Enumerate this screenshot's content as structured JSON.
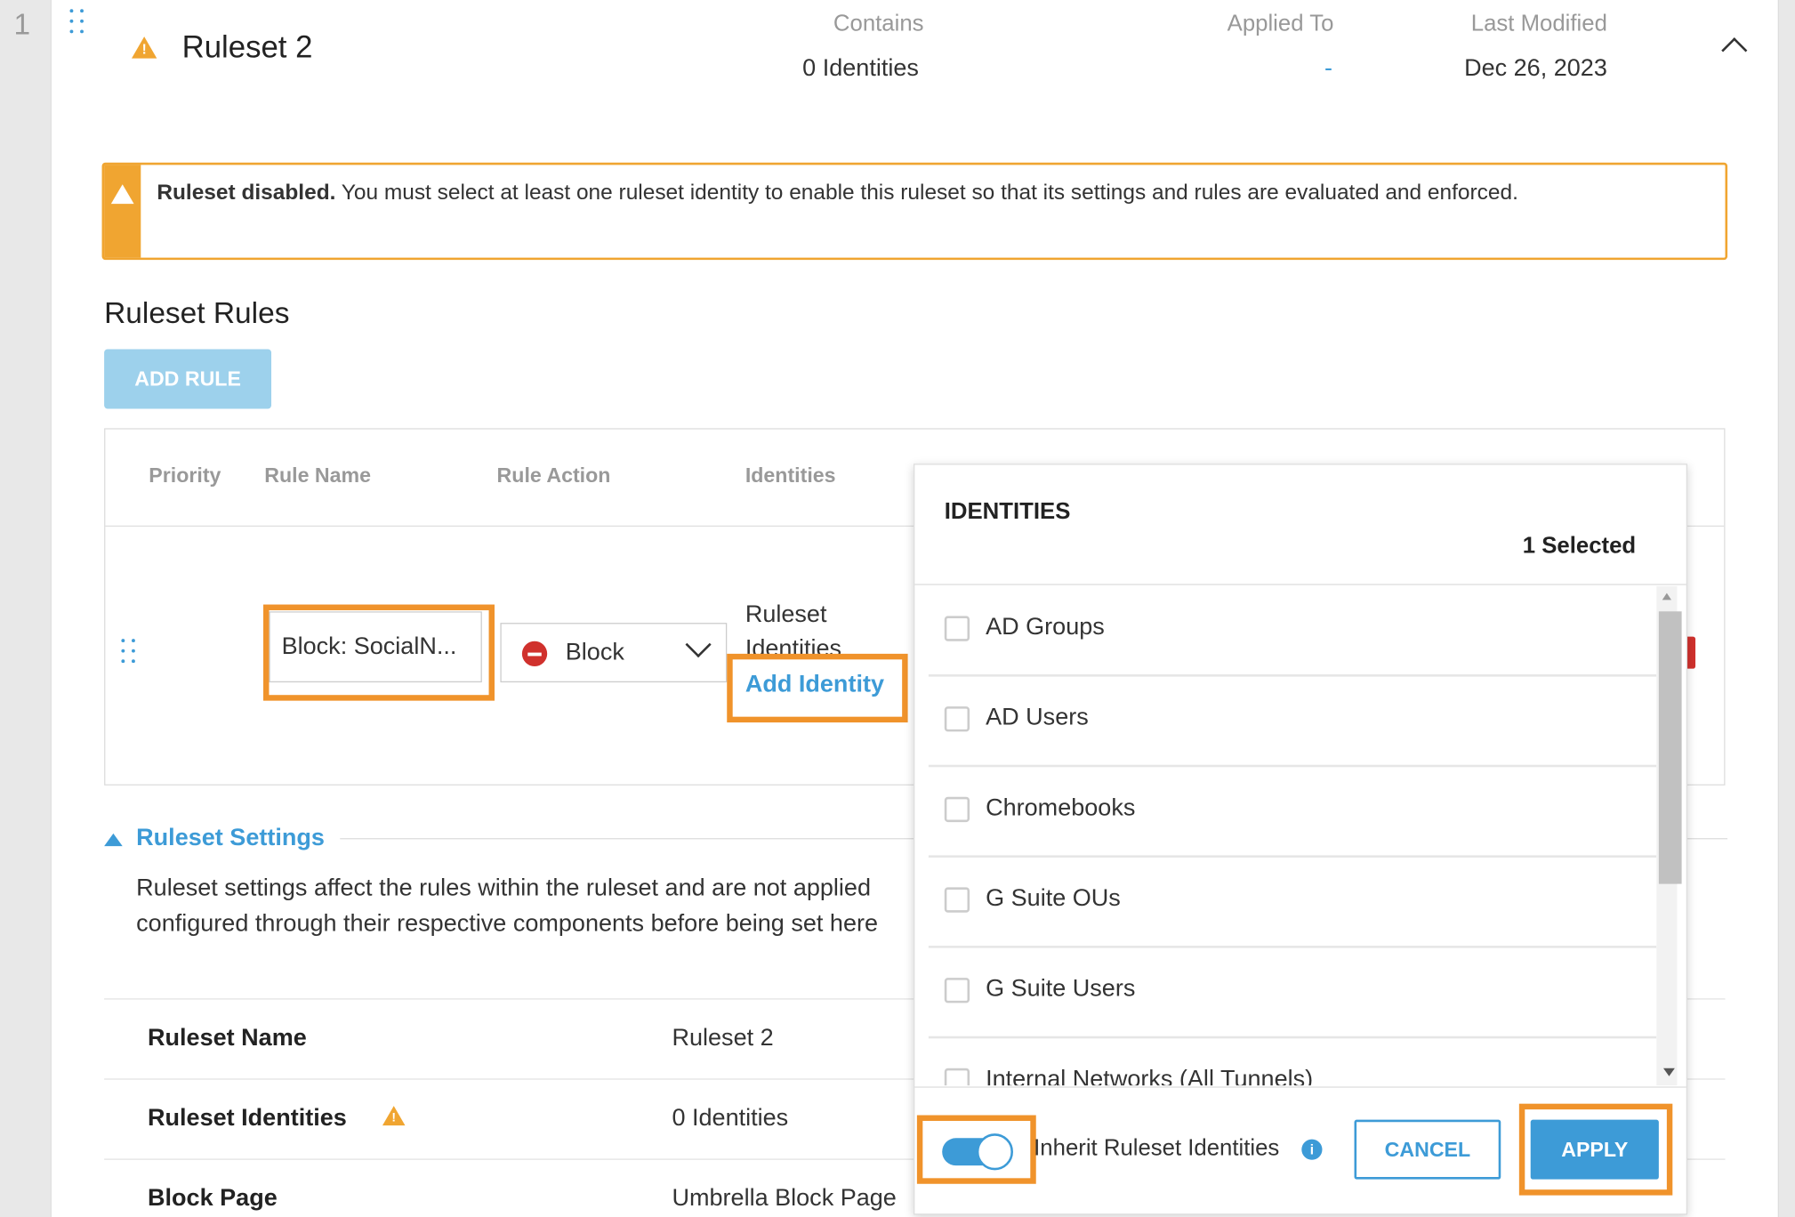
{
  "row_index": "1",
  "ruleset": {
    "title": "Ruleset 2",
    "contains_label": "Contains",
    "contains_value": "0 Identities",
    "applied_to_label": "Applied To",
    "applied_to_value": "-",
    "last_modified_label": "Last Modified",
    "last_modified_value": "Dec 26, 2023"
  },
  "alert": {
    "bold": "Ruleset disabled.",
    "message": " You must select at least one ruleset identity to enable this ruleset so that its settings and rules are evaluated and enforced."
  },
  "rules": {
    "section_title": "Ruleset Rules",
    "add_rule_label": "ADD RULE",
    "headers": [
      "Priority",
      "Rule Name",
      "Rule Action",
      "Identities"
    ],
    "row": {
      "rule_name": "Block: SocialN...",
      "action": "Block",
      "identities_text": "Ruleset Identities",
      "add_identity": "Add Identity"
    }
  },
  "settings": {
    "title": "Ruleset Settings",
    "description_line1": "Ruleset settings affect the rules within the ruleset and are not applied",
    "description_line2": "configured through their respective components before being set here",
    "rows": [
      {
        "label": "Ruleset Name",
        "value": "Ruleset 2"
      },
      {
        "label": "Ruleset Identities",
        "value": "0 Identities"
      },
      {
        "label": "Block Page",
        "value": "Umbrella Block Page"
      }
    ]
  },
  "identities_popover": {
    "title": "IDENTITIES",
    "selected_count": "1 Selected",
    "items": [
      "AD Groups",
      "AD Users",
      "Chromebooks",
      "G Suite OUs",
      "G Suite Users",
      "Internal Networks (All Tunnels)"
    ],
    "inherit_label": "Inherit Ruleset Identities",
    "inherit_enabled": true,
    "cancel_label": "CANCEL",
    "apply_label": "APPLY"
  },
  "colors": {
    "accent": "#3d9bd7",
    "warning": "#f0a531",
    "highlight": "#f0932b",
    "block_red": "#d0312d"
  }
}
